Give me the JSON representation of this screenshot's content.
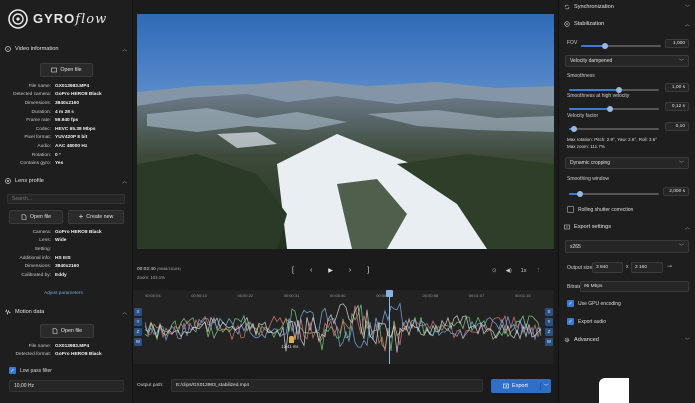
{
  "app": {
    "logo_main": "GYRO",
    "logo_script": "flow"
  },
  "video_info": {
    "title": "Video information",
    "open_button": "Open file",
    "rows": [
      {
        "k": "File name:",
        "v": "GX013983.MP4"
      },
      {
        "k": "Detected camera:",
        "v": "GoPro HERO8 Black"
      },
      {
        "k": "Dimensions:",
        "v": "3840x2160"
      },
      {
        "k": "Duration:",
        "v": "4 m 28 s"
      },
      {
        "k": "Frame rate:",
        "v": "59.940 fps"
      },
      {
        "k": "Codec:",
        "v": "HEVC 65.38 Mbps"
      },
      {
        "k": "Pixel format:",
        "v": "YUV420P 8 bit"
      },
      {
        "k": "Audio:",
        "v": "AAC 48000 Hz"
      },
      {
        "k": "Rotation:",
        "v": "0 °"
      },
      {
        "k": "Contains gyro:",
        "v": "Yes"
      }
    ]
  },
  "lens_profile": {
    "title": "Lens profile",
    "search_placeholder": "Search...",
    "open_button": "Open file",
    "create_button": "Create new",
    "rows": [
      {
        "k": "Camera:",
        "v": "GoPro HERO8 Black"
      },
      {
        "k": "Lens:",
        "v": "Wide"
      },
      {
        "k": "Setting:",
        "v": ""
      },
      {
        "k": "Additional info:",
        "v": "HS EIS"
      },
      {
        "k": "Dimensions:",
        "v": "3840x2160"
      },
      {
        "k": "Calibrated by:",
        "v": "Eddy"
      }
    ],
    "adjust_link": "Adjust parameters"
  },
  "motion_data": {
    "title": "Motion data",
    "open_button": "Open file",
    "rows": [
      {
        "k": "File name:",
        "v": "GX013983.MP4"
      },
      {
        "k": "Detected format:",
        "v": "GoPro HERO8 Black"
      }
    ],
    "lowpass_label": "Low pass filter",
    "lowpass_checked": true,
    "lowpass_value": "10,00 Hz"
  },
  "transport": {
    "time": "00:02:40",
    "frame": "(9848/16104)",
    "zoom": "Zoom: 103.1%",
    "speed": "1x"
  },
  "timeline": {
    "ticks": [
      "00:00:04",
      "00:00:13",
      "00:00:22",
      "00:00:31",
      "00:00:40",
      "00:00:49",
      "00:00:58",
      "00:01:07",
      "00:01:15"
    ],
    "playhead_fraction": 0.615,
    "sync_label": "12.41 ms",
    "sync_fraction": 0.37,
    "left_buttons": [
      "X",
      "Y",
      "Z",
      "W"
    ],
    "right_buttons": [
      "X",
      "Y",
      "Z",
      "W"
    ],
    "series_colors": [
      "#7fd17f",
      "#e07a7a",
      "#7fb0e8",
      "#d8d8d8"
    ]
  },
  "bottom": {
    "output_label": "Output path:",
    "output_value": "E:/clips/GX013983_stabilized.mp4",
    "export_button": "Export"
  },
  "sync": {
    "title": "Synchronization"
  },
  "stabilization": {
    "title": "Stabilization",
    "fov_label": "FOV",
    "fov_value": "1,000",
    "fov_fraction": 0.3,
    "method": "Velocity dampened",
    "smoothness_label": "Smoothness",
    "smoothness_value": "1,00 s",
    "smoothness_fraction": 0.55,
    "smoothness_high_label": "Smoothness at high velocity",
    "smoothness_high_value": "0,12 s",
    "smoothness_high_fraction": 0.45,
    "velocity_factor_label": "Velocity factor",
    "velocity_factor_value": "0,10",
    "velocity_factor_fraction": 0.05,
    "max_rotation": "Max rotation: Pitch: 2.9°, Yaw: 2.6°, Roll: 3.6°",
    "max_zoom": "Max zoom: 111.7%",
    "cropping": "Dynamic cropping",
    "smoothing_window_label": "Smoothing window",
    "smoothing_window_value": "2,000 s",
    "smoothing_window_fraction": 0.12,
    "rolling_shutter_label": "Rolling shutter correction",
    "rolling_shutter_checked": false
  },
  "export": {
    "title": "Export settings",
    "codec": "x265",
    "output_size_label": "Output size",
    "width": "3 840",
    "times": "x",
    "height": "2 160",
    "bitrate_label": "Bitrate",
    "bitrate_value": "95 Mbps",
    "gpu_label": "Use GPU encoding",
    "gpu_checked": true,
    "audio_label": "Export audio",
    "audio_checked": true
  },
  "advanced": {
    "title": "Advanced"
  },
  "colors": {
    "accent": "#3b7bd4",
    "panel": "#1e1e1e",
    "background": "#1b1b1b"
  }
}
